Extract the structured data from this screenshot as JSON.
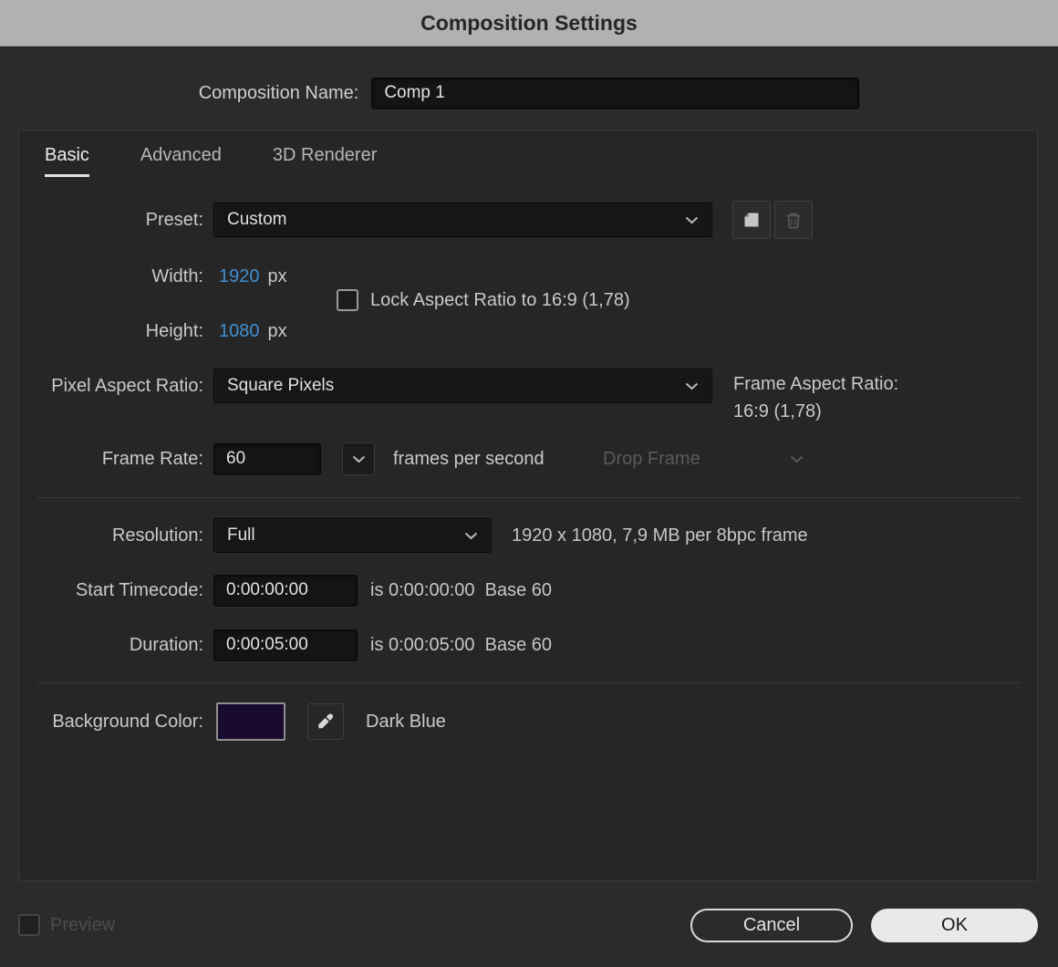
{
  "title_bar": {
    "title": "Composition Settings"
  },
  "name_row": {
    "label": "Composition Name:",
    "value": "Comp 1"
  },
  "tabs": [
    {
      "label": "Basic"
    },
    {
      "label": "Advanced"
    },
    {
      "label": "3D Renderer"
    }
  ],
  "basic": {
    "preset": {
      "label": "Preset:",
      "value": "Custom"
    },
    "width": {
      "label": "Width:",
      "value": "1920",
      "unit": "px"
    },
    "height": {
      "label": "Height:",
      "value": "1080",
      "unit": "px"
    },
    "lock_aspect": {
      "label": "Lock Aspect Ratio to 16:9 (1,78)",
      "checked": false
    },
    "pixel_aspect": {
      "label": "Pixel Aspect Ratio:",
      "value": "Square Pixels"
    },
    "frame_aspect": {
      "label": "Frame Aspect Ratio:",
      "value": "16:9 (1,78)"
    },
    "frame_rate": {
      "label": "Frame Rate:",
      "value": "60",
      "unit": "frames per second",
      "drop_frame": "Drop Frame"
    },
    "resolution": {
      "label": "Resolution:",
      "value": "Full",
      "info": "1920 x 1080, 7,9 MB per 8bpc frame"
    },
    "start_timecode": {
      "label": "Start Timecode:",
      "value": "0:00:00:00",
      "info": "is 0:00:00:00  Base 60"
    },
    "duration": {
      "label": "Duration:",
      "value": "0:00:05:00",
      "info": "is 0:00:05:00  Base 60"
    },
    "background_color": {
      "label": "Background Color:",
      "name": "Dark Blue",
      "hex": "#190b2e"
    }
  },
  "footer": {
    "preview": "Preview",
    "cancel": "Cancel",
    "ok": "OK"
  },
  "colors": {
    "accent_blue": "#3f8fd2",
    "titlebar_gray": "#b1b1b1"
  }
}
